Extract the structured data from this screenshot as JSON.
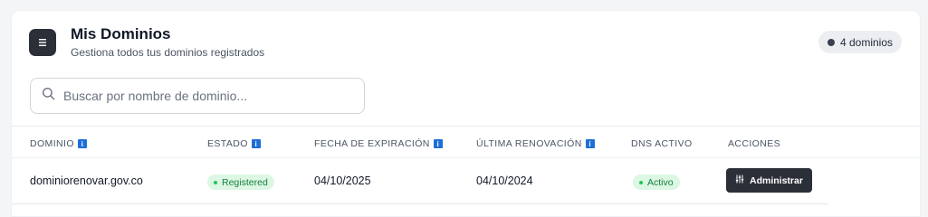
{
  "header": {
    "title": "Mis Dominios",
    "subtitle": "Gestiona todos tus dominios registrados",
    "count_badge": "4 dominios",
    "icon": "list-icon"
  },
  "search": {
    "placeholder": "Buscar por nombre de dominio...",
    "value": "",
    "icon": "search-icon"
  },
  "table": {
    "columns": [
      {
        "label": "DOMINIO",
        "info": true
      },
      {
        "label": "ESTADO",
        "info": true
      },
      {
        "label": "FECHA DE EXPIRACIÓN",
        "info": true
      },
      {
        "label": "ÚLTIMA RENOVACIÓN",
        "info": true
      },
      {
        "label": "DNS ACTIVO",
        "info": false
      },
      {
        "label": "ACCIONES",
        "info": false
      }
    ],
    "rows": [
      {
        "domain": "dominiorenovar.gov.co",
        "status": "Registered",
        "expiration": "04/10/2025",
        "last_renewal": "04/10/2024",
        "dns": "Activo",
        "action": "Administrar"
      }
    ]
  },
  "colors": {
    "accent_dark": "#2b2f38",
    "status_green_bg": "#dcf7e3",
    "status_green_text": "#15803d",
    "info_blue": "#1d6fd8"
  }
}
